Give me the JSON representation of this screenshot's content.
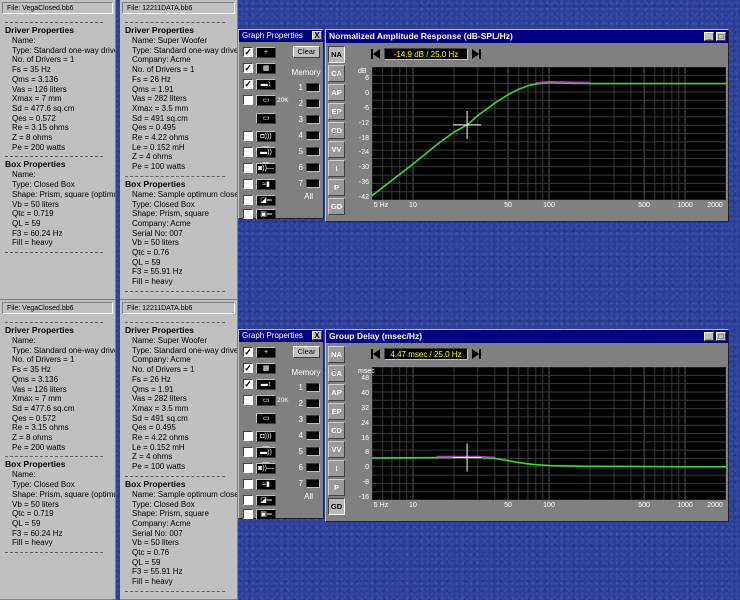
{
  "panels": [
    {
      "file": "File: VegaClosed.bb6",
      "driver_title": "Driver Properties",
      "driver": [
        "Name:",
        "Type: Standard one-way driver",
        "No. of Drivers = 1",
        "Fs = 35 Hz",
        "Qms = 3.136",
        "Vas = 126 liters",
        "Xmax = 7 mm",
        "Sd = 477.6 sq.cm",
        "Qes = 0.572",
        "Re = 3.15 ohms",
        "Z = 8 ohms",
        "Pe = 200 watts"
      ],
      "box_title": "Box Properties",
      "box": [
        "Name:",
        "Type: Closed Box",
        "Shape: Prism, square (optimum)",
        "Vb = 50 liters",
        "Qtc = 0.719",
        "QL = 59",
        "F3 = 60.24 Hz",
        "Fill = heavy"
      ]
    },
    {
      "file": "File: 12211DATA.bb6",
      "driver_title": "Driver Properties",
      "driver": [
        "Name: Super Woofer",
        "Type: Standard one-way driver",
        "Company: Acme",
        "No. of Drivers = 1",
        "Fs = 26 Hz",
        "Qms = 1.91",
        "Vas = 282 liters",
        "Xmax = 3.5 mm",
        "Sd = 491 sq.cm",
        "Qes = 0.495",
        "Re = 4.22 ohms",
        "Le = 0.152 mH",
        "Z = 4 ohms",
        "Pe = 100 watts"
      ],
      "box_title": "Box Properties",
      "box": [
        "Name: Sample optimum closed",
        "Type: Closed Box",
        "Shape: Prism, square",
        "Company: Acme",
        "Serial No: 007",
        "Vb = 50 liters",
        "Qtc = 0.76",
        "QL = 59",
        "F3 = 55.91 Hz",
        "Fill = heavy"
      ]
    }
  ],
  "graph_properties": {
    "title": "Graph Properties",
    "close": "X",
    "clear_label": "Clear",
    "memory_label": "Memory",
    "memory_slots": [
      "1",
      "2",
      "3",
      "4",
      "5",
      "6",
      "7"
    ],
    "all_label": "All",
    "zoom_label": "20K"
  },
  "graphs": [
    {
      "title": "Normalized Amplitude Response (dB-SPL/Hz)",
      "readout": "-14.9 dB / 25.0 Hz",
      "unit": "dB",
      "active_tab": "NA",
      "ticks": [
        "6",
        "0",
        "-6",
        "-12",
        "-18",
        "-24",
        "-30",
        "-36",
        "-42"
      ]
    },
    {
      "title": "Group Delay (msec/Hz)",
      "readout": "4.47 msec / 25.0 Hz",
      "unit": "msec",
      "active_tab": "GD",
      "ticks": [
        "48",
        "40",
        "32",
        "24",
        "16",
        "8",
        "0",
        "-8",
        "-16"
      ]
    }
  ],
  "tabs": [
    "NA",
    "CA",
    "AP",
    "EP",
    "CD",
    "VV",
    "I",
    "P",
    "GD"
  ],
  "x_ticks": [
    "5 Hz",
    "10",
    "50",
    "100",
    "500",
    "1000",
    "2000"
  ],
  "win_buttons": {
    "minimize": "_",
    "maximize": "□"
  },
  "colors": {
    "trace": "#33dd33",
    "trace2": "#b040c0",
    "background": "#000000",
    "grid": "#3a3a3a",
    "titlebar": "#000080",
    "readout_text": "#ffff00"
  },
  "chart_data": [
    {
      "type": "line",
      "title": "Normalized Amplitude Response (dB-SPL/Hz)",
      "ylabel": "dB",
      "x_scale": "log",
      "xlim": [
        5,
        2000
      ],
      "ylim": [
        -42,
        6
      ],
      "x": [
        5,
        10,
        15,
        20,
        25,
        30,
        40,
        50,
        60,
        70,
        80,
        100,
        150,
        200,
        500,
        1000,
        2000
      ],
      "series": [
        {
          "values": [
            -40.5,
            -29.0,
            -22.0,
            -17.5,
            -14.9,
            -11.5,
            -7.0,
            -4.0,
            -2.0,
            -0.8,
            -0.1,
            0.3,
            0.1,
            0.0,
            0.0,
            0.0,
            0.0
          ]
        }
      ],
      "grid": true
    },
    {
      "type": "line",
      "title": "Group Delay (msec/Hz)",
      "ylabel": "msec",
      "x_scale": "log",
      "xlim": [
        5,
        2000
      ],
      "ylim": [
        -16,
        48
      ],
      "x": [
        5,
        10,
        15,
        20,
        25,
        30,
        40,
        50,
        60,
        70,
        80,
        100,
        150,
        200,
        500,
        1000,
        2000
      ],
      "series": [
        {
          "values": [
            4.2,
            4.3,
            4.4,
            4.45,
            4.47,
            4.4,
            4.0,
            3.0,
            2.0,
            1.4,
            1.0,
            0.6,
            0.3,
            0.2,
            0.1,
            0.0,
            0.0
          ]
        }
      ],
      "grid": true
    }
  ]
}
